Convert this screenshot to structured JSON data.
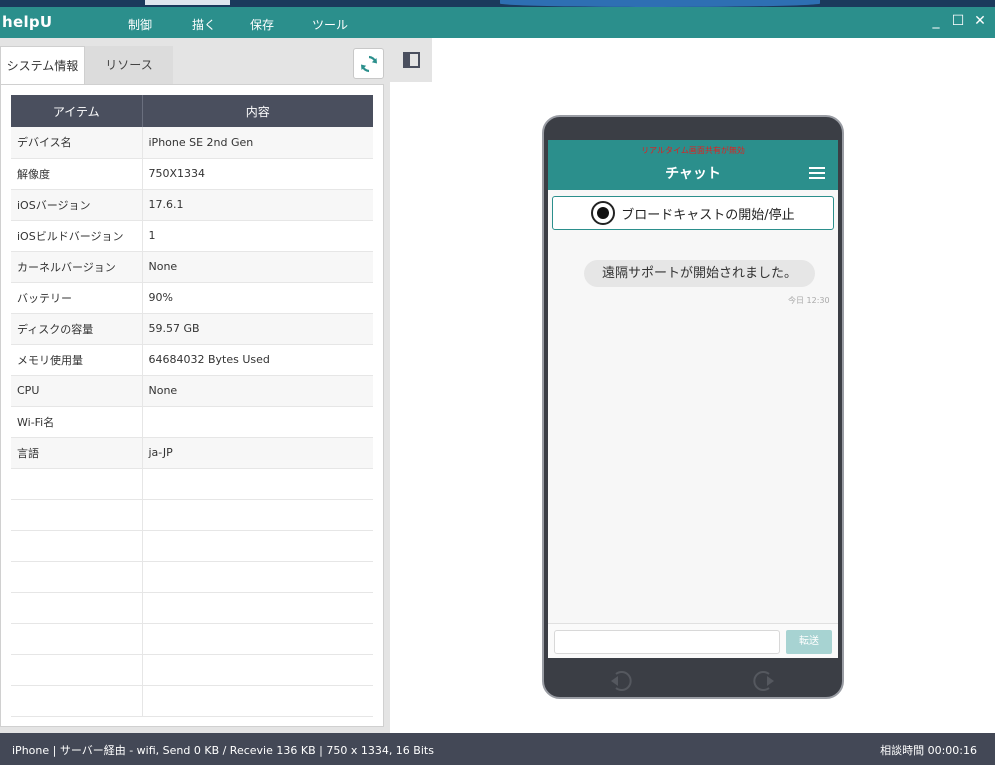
{
  "app": {
    "title": "helpU",
    "menu": [
      "制御",
      "描く",
      "保存",
      "ツール"
    ],
    "window_controls": {
      "minimize": "_",
      "maximize": "☐",
      "close": "✕"
    }
  },
  "tabs": [
    {
      "label": "システム情報",
      "active": true
    },
    {
      "label": "リソース",
      "active": false
    }
  ],
  "icons": {
    "refresh": "refresh-icon",
    "collapse": "panel-collapse-icon",
    "record": "record-icon",
    "menu": "hamburger-menu-icon",
    "back": "back-icon",
    "rotate": "rotate-icon"
  },
  "table": {
    "headers": [
      "アイテム",
      "内容"
    ],
    "rows": [
      [
        "デバイス名",
        "iPhone SE 2nd Gen"
      ],
      [
        "解像度",
        "750X1334"
      ],
      [
        "iOSバージョン",
        "17.6.1"
      ],
      [
        "iOSビルドバージョン",
        "1"
      ],
      [
        "カーネルバージョン",
        "None"
      ],
      [
        "バッテリー",
        "90%"
      ],
      [
        "ディスクの容量",
        "59.57 GB"
      ],
      [
        "メモリ使用量",
        "64684032 Bytes Used"
      ],
      [
        "CPU",
        "None"
      ],
      [
        "Wi-Fi名",
        ""
      ],
      [
        "言語",
        "ja-JP"
      ]
    ]
  },
  "phone": {
    "share_warning": "リアルタイム画面共有が無効",
    "chat_title": "チャット",
    "broadcast_label": "ブロードキャストの開始/停止",
    "message": "遠隔サポートが開始されました。",
    "timestamp": "今日 12:30",
    "input_placeholder": "",
    "send_label": "転送"
  },
  "status": {
    "left": "iPhone | サーバー経由 - wifi, Send 0 KB / Recevie 136 KB | 750 x 1334, 16 Bits",
    "right": "相談時間 00:00:16"
  },
  "colors": {
    "teal": "#2b8f8c",
    "header_dark": "#4a4f5e",
    "status_bar": "#434856",
    "warning_red": "#e02020"
  }
}
